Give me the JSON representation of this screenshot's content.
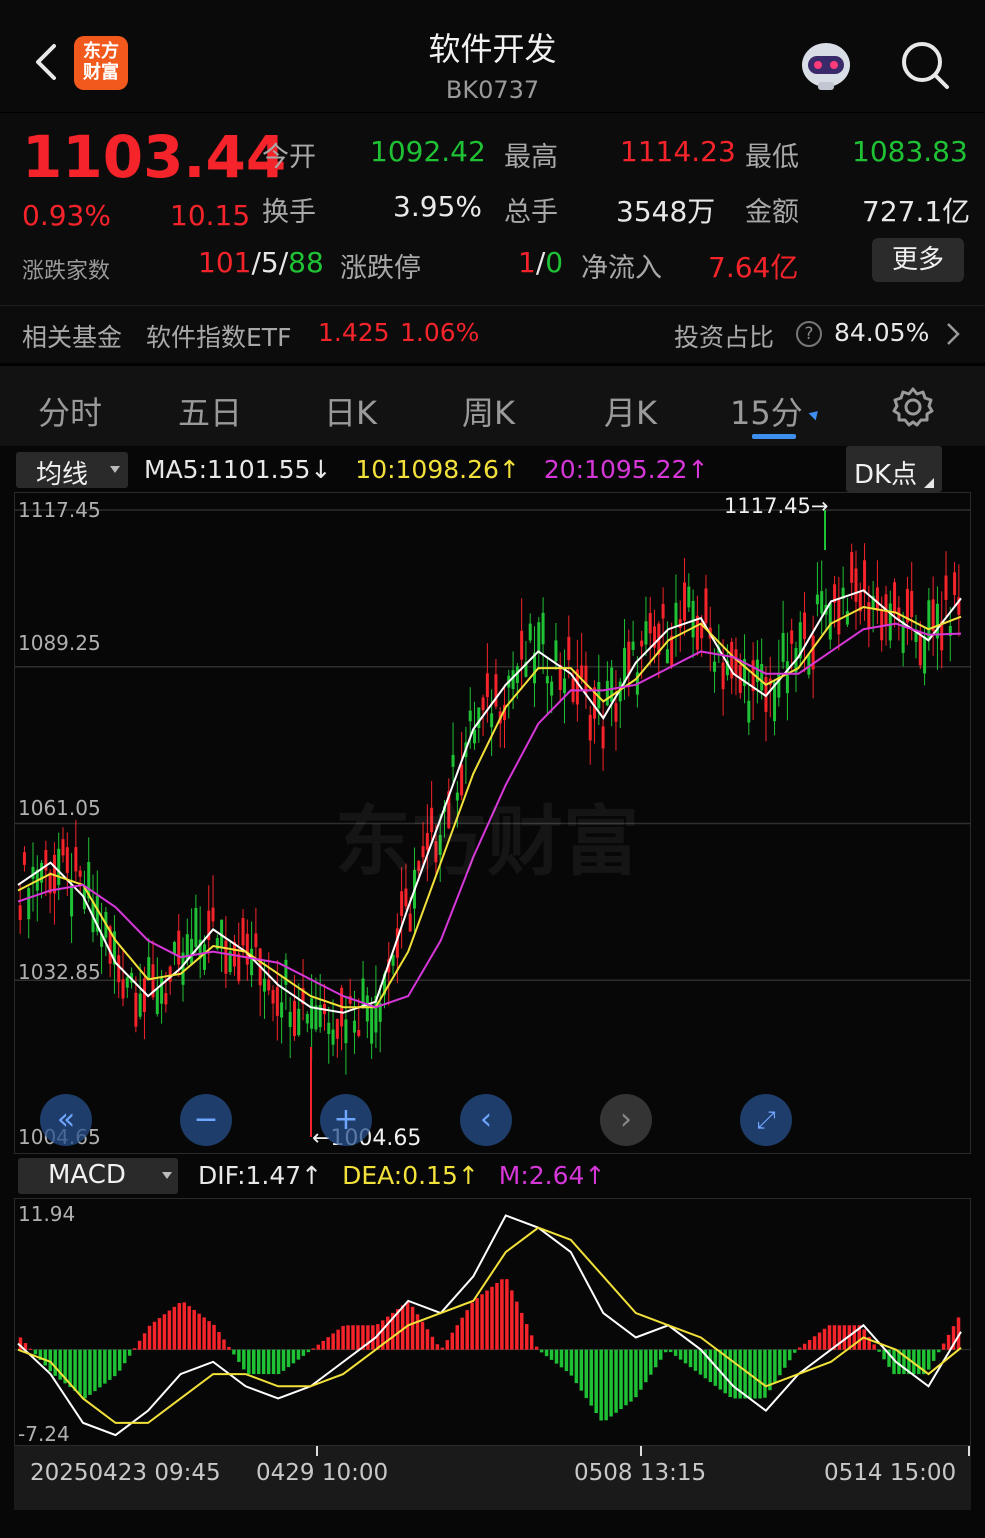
{
  "header": {
    "title": "软件开发",
    "code": "BK0737",
    "logo_text_line1": "东方",
    "logo_text_line2": "财富",
    "back_icon": "chevron-left-icon",
    "robot_icon": "robot-assistant-icon",
    "search_icon": "search-icon"
  },
  "quote": {
    "price": "1103.44",
    "change_pct": "0.93%",
    "change_abs": "10.15",
    "open_label": "今开",
    "open": "1092.42",
    "high_label": "最高",
    "high": "1114.23",
    "low_label": "最低",
    "low": "1083.83",
    "turnover_label": "换手",
    "turnover": "3.95%",
    "volume_label": "总手",
    "volume": "3548万",
    "amount_label": "金额",
    "amount": "727.1亿",
    "breadth_label": "涨跌家数",
    "breadth_up": "101",
    "breadth_flat": "5",
    "breadth_down": "88",
    "limit_label": "涨跌停",
    "limit_up": "1",
    "limit_down": "0",
    "netflow_label": "净流入",
    "netflow": "7.64亿",
    "more_label": "更多"
  },
  "fund": {
    "label": "相关基金",
    "name": "软件指数ETF",
    "price": "1.425",
    "pct": "1.06%",
    "ratio_label": "投资占比",
    "ratio": "84.05%"
  },
  "tabs": [
    "分时",
    "五日",
    "日K",
    "周K",
    "月K",
    "15分"
  ],
  "active_tab": "15分",
  "main_chart": {
    "indicator_dropdown": "均线",
    "ma5": "MA5:1101.55",
    "ma5_arrow": "↓",
    "ma10": "10:1098.26",
    "ma10_arrow": "↑",
    "ma20": "20:1095.22",
    "ma20_arrow": "↑",
    "dk_label": "DK点",
    "y_labels": [
      "1117.45",
      "1089.25",
      "1061.05",
      "1032.85",
      "1004.65"
    ],
    "max_label": "1117.45→",
    "min_label": "←1004.65",
    "watermark": "东方财富"
  },
  "sub_chart": {
    "indicator_dropdown": "MACD",
    "dif": "DIF:1.47",
    "dif_arrow": "↑",
    "dea": "DEA:0.15",
    "dea_arrow": "↑",
    "m": "M:2.64",
    "m_arrow": "↑",
    "y_top": "11.94",
    "y_bottom": "-7.24"
  },
  "x_axis": {
    "labels": [
      "20250423 09:45",
      "0429 10:00",
      "0508 13:15",
      "0514 15:00"
    ]
  },
  "colors": {
    "up": "#f5232a",
    "down": "#1fc234",
    "ma5": "#ffffff",
    "ma10": "#f2e13a",
    "ma20": "#d637d8",
    "accent": "#3f8ff0"
  },
  "chart_data": {
    "type": "line",
    "title": "",
    "ylim": [
      1004.65,
      1117.45
    ],
    "series": [
      {
        "name": "MA5",
        "values": [
          1050,
          1054,
          1048,
          1036,
          1030,
          1035,
          1042,
          1038,
          1032,
          1028,
          1027,
          1029,
          1046,
          1062,
          1078,
          1086,
          1092,
          1088,
          1080,
          1090,
          1096,
          1098,
          1088,
          1084,
          1091,
          1101,
          1103,
          1098,
          1094,
          1101.55
        ]
      },
      {
        "name": "10",
        "values": [
          1049,
          1052,
          1050,
          1040,
          1033,
          1034,
          1039,
          1038,
          1034,
          1030,
          1028,
          1028,
          1038,
          1054,
          1070,
          1082,
          1089,
          1089,
          1083,
          1087,
          1094,
          1097,
          1091,
          1086,
          1089,
          1097,
          1100,
          1099,
          1096,
          1098.26
        ]
      },
      {
        "name": "20",
        "values": [
          1047,
          1049,
          1050,
          1046,
          1040,
          1037,
          1038,
          1037,
          1036,
          1033,
          1030,
          1028,
          1030,
          1040,
          1055,
          1068,
          1079,
          1085,
          1085,
          1086,
          1089,
          1092,
          1091,
          1088,
          1088,
          1092,
          1096,
          1097,
          1095,
          1095.22
        ]
      }
    ],
    "max_value": 1117.45,
    "min_value": 1004.65,
    "macd": {
      "dif": [
        0.5,
        -2,
        -6,
        -7,
        -5,
        -2,
        -1,
        -3,
        -4,
        -3,
        -1,
        1,
        4,
        3,
        6,
        11,
        10,
        8,
        3,
        1,
        2,
        0,
        -3,
        -5,
        -2,
        0,
        2,
        -1,
        -3,
        1.47
      ],
      "dea": [
        0,
        -1,
        -4,
        -6,
        -6,
        -4,
        -2,
        -2,
        -3,
        -3,
        -2,
        0,
        2,
        3,
        4,
        8,
        10,
        9,
        6,
        3,
        2,
        1,
        -1,
        -3,
        -2,
        -1,
        1,
        0,
        -2,
        0.15
      ]
    }
  }
}
